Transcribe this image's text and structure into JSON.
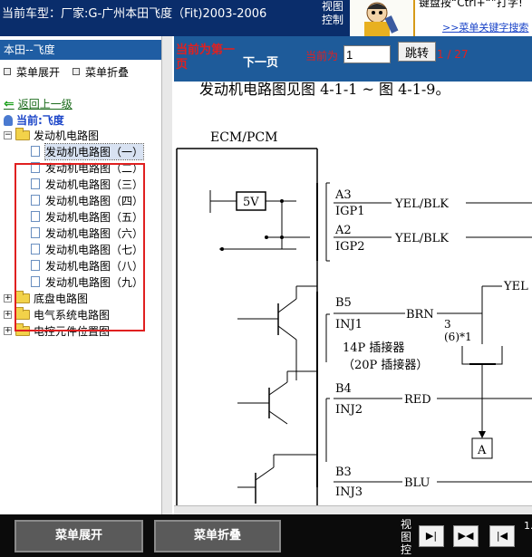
{
  "topbar": {
    "car_title": "当前车型：厂家:G-广州本田飞度（Fit)2003-2006",
    "view_control": "视图控制",
    "tip_text": "键盘按“Ctrl+“”打字!",
    "tip_link": ">>菜单关键字搜索"
  },
  "left": {
    "header": "本田--飞度",
    "expand_label": "菜单展开",
    "collapse_label": "菜单折叠",
    "back_label": "返回上一级",
    "current_label": "当前:飞度",
    "tree": {
      "root": "发动机电路图",
      "children": [
        "发动机电路图（一）",
        "发动机电路图（二）",
        "发动机电路图（三）",
        "发动机电路图（四）",
        "发动机电路图（五）",
        "发动机电路图（六）",
        "发动机电路图（七）",
        "发动机电路图（八）",
        "发动机电路图（九）"
      ],
      "siblings": [
        "底盘电路图",
        "电气系统电路图",
        "电控元件位置图"
      ]
    }
  },
  "nav": {
    "current_page_label": "当前为第一页",
    "next_page": "下一页",
    "current_label": "当前为",
    "page_value": "1",
    "jump_label": "跳转",
    "total": "1 / 27"
  },
  "diagram": {
    "caption": "发动机电路图见图 4-1-1 ~ 图 4-1-9。",
    "ecm_label": "ECM/PCM",
    "v5_label": "5V",
    "pins": [
      {
        "id": "A3",
        "name": "IGP1",
        "wire": "YEL/BLK"
      },
      {
        "id": "A2",
        "name": "IGP2",
        "wire": "YEL/BLK"
      },
      {
        "id": "B5",
        "name": "INJ1",
        "wire": "BRN"
      },
      {
        "id": "B4",
        "name": "INJ2",
        "wire": "RED"
      },
      {
        "id": "B3",
        "name": "INJ3",
        "wire": "BLU"
      }
    ],
    "connector_note1": "14P 插接器",
    "connector_note2": "（20P 插接器）",
    "pin3_label": "3",
    "pin6_label": "(6)*1",
    "yel_label": "YEL",
    "a_label": "A"
  },
  "bottom": {
    "expand_btn": "菜单展开",
    "collapse_btn": "菜单折叠",
    "view_label": "视图控",
    "edge_text": "1."
  },
  "colors": {
    "topbar_bg": "#0a2d6b",
    "nav_bg": "#1e5b9a",
    "header_bg": "#1f5da3",
    "highlight_red": "#e02020"
  }
}
